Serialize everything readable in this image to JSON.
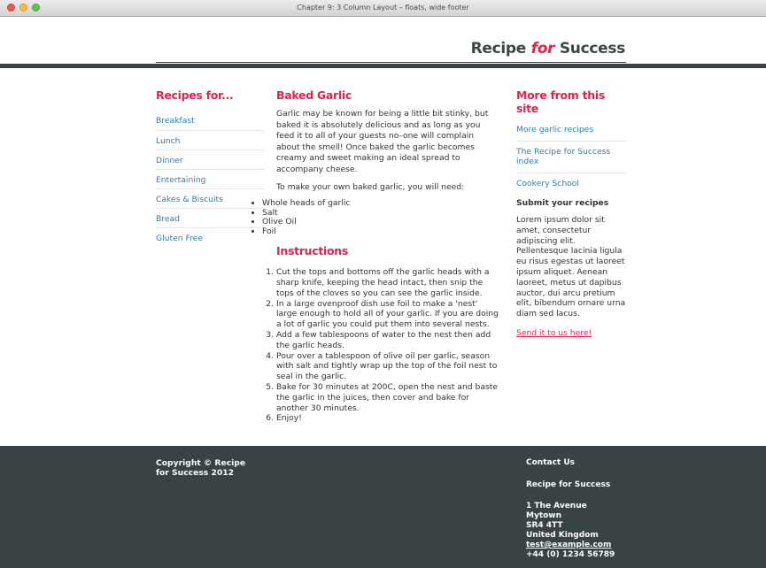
{
  "window": {
    "title": "Chapter 9: 3 Column Layout – floats, wide footer"
  },
  "brand": {
    "part1": "Recipe",
    "accent": "for",
    "part2": "Success"
  },
  "left": {
    "heading": "Recipes for...",
    "items": [
      "Breakfast",
      "Lunch",
      "Dinner",
      "Entertaining",
      "Cakes & Biscuits",
      "Bread",
      "Gluten Free"
    ]
  },
  "main": {
    "heading": "Baked Garlic",
    "intro": "Garlic may be known for being a little bit stinky, but baked it is absolutely delicious and as long as you feed it to all of your guests no–one will complain about the smell! Once baked the garlic becomes creamy and sweet making an ideal spread to accompany cheese.",
    "lead": "To make your own baked garlic, you will need:",
    "ingredients": [
      "Whole heads of garlic",
      "Salt",
      "Olive Oil",
      "Foil"
    ],
    "instructions_heading": "Instructions",
    "steps": [
      "Cut the tops and bottoms off the garlic heads with a sharp knife, keeping the head intact, then snip the tops of the cloves so you can see the garlic inside.",
      "In a large ovenproof dish use foil to make a 'nest' large enough to hold all of your garlic. If you are doing a lot of garlic you could put them into several nests.",
      "Add a few tablespoons of water to the nest then add the garlic heads.",
      "Pour over a tablespoon of olive oil per garlic, season with salt and tightly wrap up the top of the foil nest to seal in the garlic.",
      "Bake for 30 minutes at 200C, open the nest and baste the garlic in the juices, then cover and bake for another 30 minutes.",
      "Enjoy!"
    ]
  },
  "right": {
    "heading": "More from this site",
    "links": [
      "More garlic recipes",
      "The Recipe for Success index",
      "Cookery School"
    ],
    "submit_heading": "Submit your recipes",
    "submit_text": "Lorem ipsum dolor sit amet, consectetur adipiscing elit. Pellentesque lacinia ligula eu risus egestas ut laoreet ipsum aliquet. Aenean laoreet, metus ut dapibus auctor, dui arcu pretium elit, bibendum ornare urna diam sed lacus.",
    "send_link": "Send it to us here!"
  },
  "footer": {
    "copyright": "Copyright © Recipe for Success 2012",
    "contact_heading": "Contact Us",
    "org": "Recipe for Success",
    "address": [
      "1 The Avenue",
      "Mytown",
      "SR4 4TT",
      "United Kingdom"
    ],
    "email": "test@example.com",
    "phone": "+44 (0) 1234 56789"
  }
}
